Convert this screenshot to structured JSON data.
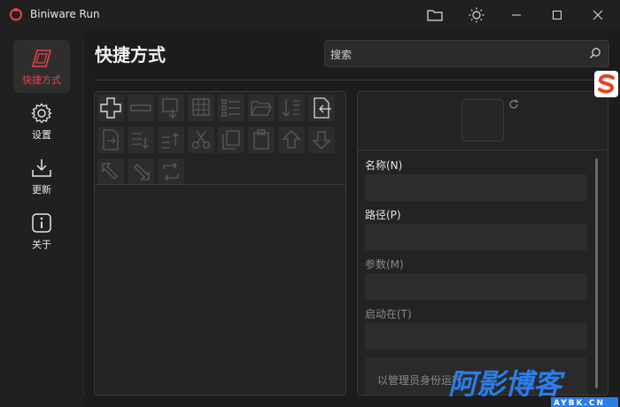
{
  "window": {
    "title": "Biniware Run",
    "accent": "#e9414d"
  },
  "nav": {
    "items": [
      {
        "label": "快捷方式",
        "icon": "shortcut-icon",
        "active": true
      },
      {
        "label": "设置",
        "icon": "gear-icon",
        "active": false
      },
      {
        "label": "更新",
        "icon": "download-icon",
        "active": false
      },
      {
        "label": "关于",
        "icon": "info-icon",
        "active": false
      }
    ]
  },
  "main": {
    "title": "快捷方式",
    "search": {
      "placeholder": "搜索"
    }
  },
  "toolbar": {
    "tools": [
      "add-icon",
      "remove-icon",
      "add-shortcut-icon",
      "grid-icon",
      "list-icon",
      "folder-open-icon",
      "sort-icon",
      "import-icon",
      "export-icon",
      "indent-icon",
      "outdent-icon",
      "cut-icon",
      "copy-icon",
      "paste-icon",
      "move-up-icon",
      "move-down-icon",
      "expand-icon",
      "collapse-icon",
      "refresh-icon"
    ]
  },
  "details": {
    "name_label": "名称(N)",
    "path_label": "路径(P)",
    "args_label": "参数(M)",
    "start_in_label": "启动在(T)",
    "run_as_admin": "以管理员身份运行"
  },
  "watermark": {
    "text": "阿影博客",
    "subtext": "AYBK.CN"
  }
}
